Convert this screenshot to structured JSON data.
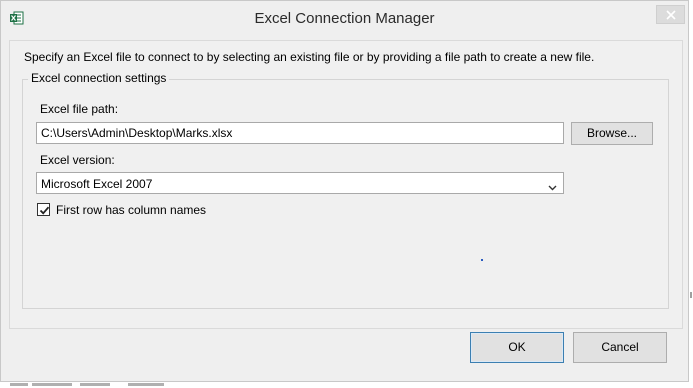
{
  "window": {
    "title": "Excel Connection Manager",
    "app_icon": "excel-icon",
    "close_icon": "close-icon"
  },
  "description": "Specify an Excel file to connect to by selecting an existing file or by providing a file path to create a new file.",
  "settings": {
    "group_label": "Excel connection settings",
    "file_path_label": "Excel file path:",
    "file_path_value": "C:\\Users\\Admin\\Desktop\\Marks.xlsx",
    "browse_label": "Browse...",
    "version_label": "Excel version:",
    "version_value": "Microsoft Excel 2007",
    "first_row_label": "First row has column names",
    "first_row_checked": true
  },
  "buttons": {
    "ok_label": "OK",
    "cancel_label": "Cancel"
  }
}
